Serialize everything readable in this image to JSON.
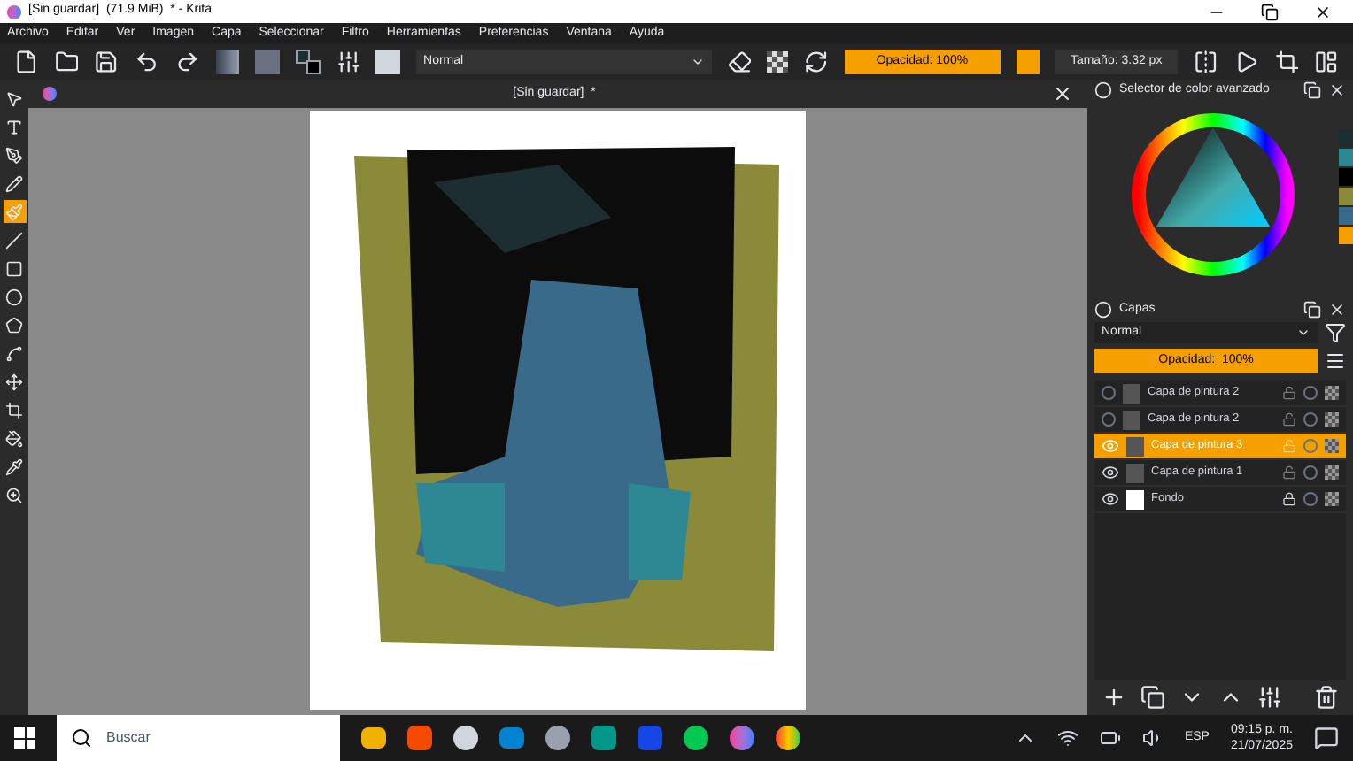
{
  "window": {
    "title": "[Sin guardar]  (71.9 MiB)  * - Krita"
  },
  "menu": [
    "Archivo",
    "Editar",
    "Ver",
    "Imagen",
    "Capa",
    "Seleccionar",
    "Filtro",
    "Herramientas",
    "Preferencias",
    "Ventana",
    "Ayuda"
  ],
  "toolbar": {
    "blend_mode": "Normal",
    "opacity": {
      "label": "Opacidad: 100%",
      "level": 1
    },
    "size": "Tamaño: 3.32 px"
  },
  "tools": [
    {
      "kind": "pointer",
      "selected": false
    },
    {
      "kind": "text",
      "selected": false
    },
    {
      "kind": "calligraphy",
      "selected": false
    },
    {
      "kind": "pen",
      "selected": false
    },
    {
      "kind": "brush",
      "selected": true
    },
    {
      "kind": "line",
      "selected": false
    },
    {
      "kind": "rect",
      "selected": false
    },
    {
      "kind": "ellipse",
      "selected": false
    },
    {
      "kind": "polygon",
      "selected": false
    },
    {
      "kind": "path",
      "selected": false
    },
    {
      "kind": "move",
      "selected": false
    },
    {
      "kind": "crop",
      "selected": false
    },
    {
      "kind": "fill",
      "selected": false
    },
    {
      "kind": "picker",
      "selected": false
    },
    {
      "kind": "zoom",
      "selected": false
    }
  ],
  "document_tab": {
    "title": "[Sin guardar]  *"
  },
  "color_panel": {
    "title": "Selector de color avanzado",
    "swatches": [
      {
        "color": "#1c2e31"
      },
      {
        "color": "#2e8894"
      },
      {
        "color": "#000000"
      },
      {
        "color": "#8a8a38"
      },
      {
        "color": "#3a6a8a"
      },
      {
        "color": "#f5a000"
      }
    ]
  },
  "layers_panel": {
    "title": "Capas",
    "blend_mode": "Normal",
    "opacity": {
      "label": "Opacidad:  100%",
      "level": 1
    },
    "layers": [
      {
        "name": "Capa de pintura 2",
        "visible": false,
        "selected": false,
        "locked": false
      },
      {
        "name": "Capa de pintura 2",
        "visible": false,
        "selected": false,
        "locked": false
      },
      {
        "name": "Capa de pintura 3",
        "visible": true,
        "selected": true,
        "locked": false
      },
      {
        "name": "Capa de pintura 1",
        "visible": true,
        "selected": false,
        "locked": false
      },
      {
        "name": "Fondo",
        "visible": true,
        "selected": false,
        "locked": true
      }
    ]
  },
  "taskbar": {
    "search_placeholder": "Buscar",
    "language": "ESP",
    "time": "09:15 p. m.",
    "date": "21/07/2025"
  }
}
